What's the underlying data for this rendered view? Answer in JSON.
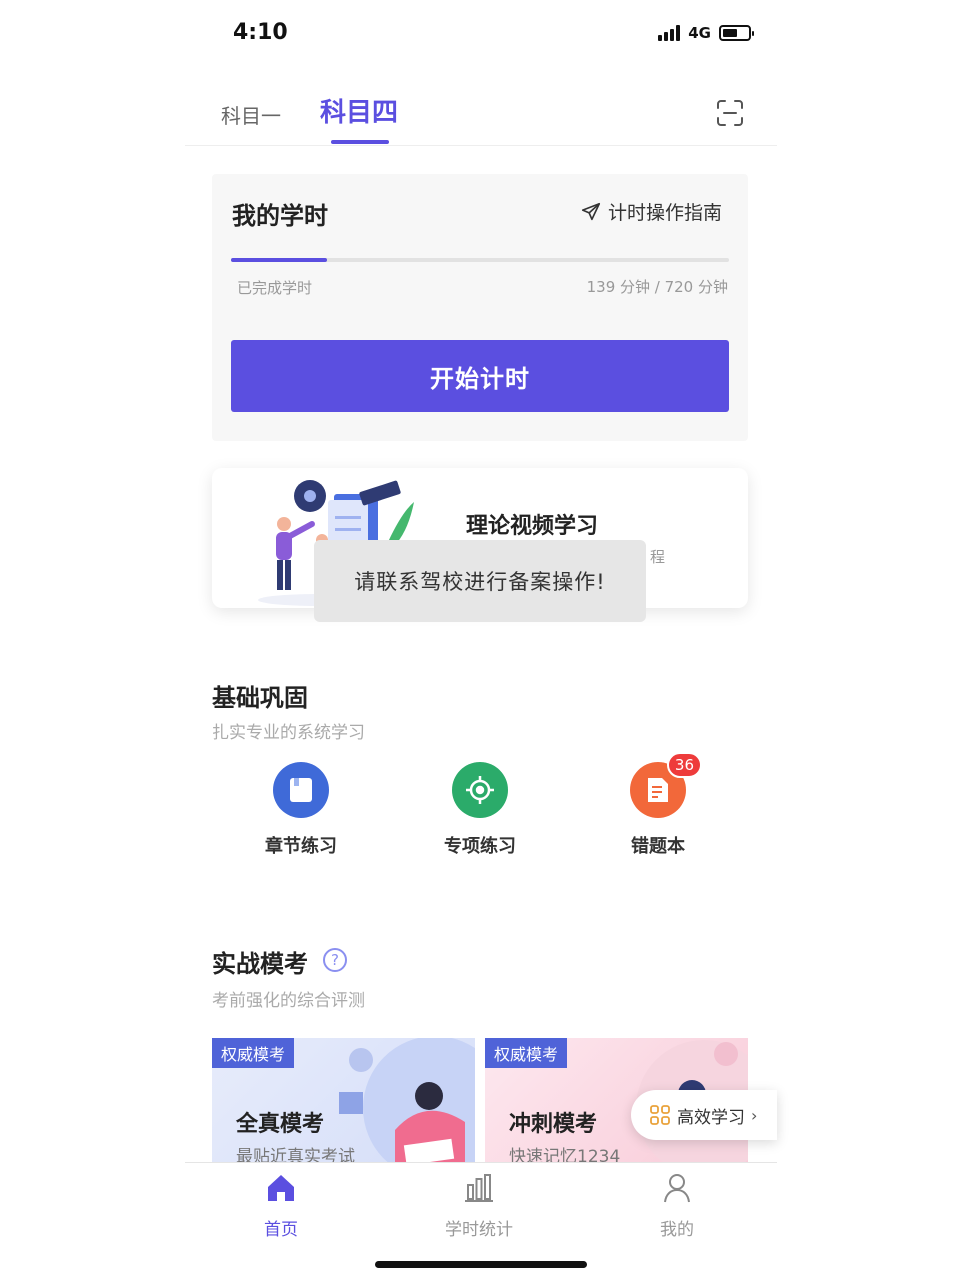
{
  "status_bar": {
    "time": "4:10",
    "network": "4G"
  },
  "tabs": {
    "subject1": "科目一",
    "subject4": "科目四"
  },
  "hours_card": {
    "title": "我的学时",
    "guide_label": "计时操作指南",
    "completed_label": "已完成学时",
    "completed_value": "139 分钟 / 720 分钟",
    "progress_fraction": 0.193,
    "start_button": "开始计时"
  },
  "video_card": {
    "title": "理论视频学习",
    "subtitle_fragment": "程"
  },
  "toast": {
    "message": "请联系驾校进行备案操作!"
  },
  "basics": {
    "title": "基础巩固",
    "subtitle": "扎实专业的系统学习",
    "items": [
      {
        "label": "章节练习",
        "icon": "book-icon",
        "color": "#3f6ad8"
      },
      {
        "label": "专项练习",
        "icon": "target-icon",
        "color": "#2bab6a"
      },
      {
        "label": "错题本",
        "icon": "document-icon",
        "color": "#f2683a",
        "badge": "36"
      }
    ]
  },
  "mock_exam": {
    "title": "实战模考",
    "subtitle": "考前强化的综合评测",
    "cards": [
      {
        "tag": "权威模考",
        "title": "全真模考",
        "subtitle": "最贴近真实考试"
      },
      {
        "tag": "权威模考",
        "title": "冲刺模考",
        "subtitle": "快速记忆1234"
      }
    ],
    "float_button": "高效学习"
  },
  "bottom_nav": {
    "home": "首页",
    "stats": "学时统计",
    "mine": "我的"
  },
  "colors": {
    "accent": "#5b4fe0",
    "badge": "#ee3b3b"
  }
}
